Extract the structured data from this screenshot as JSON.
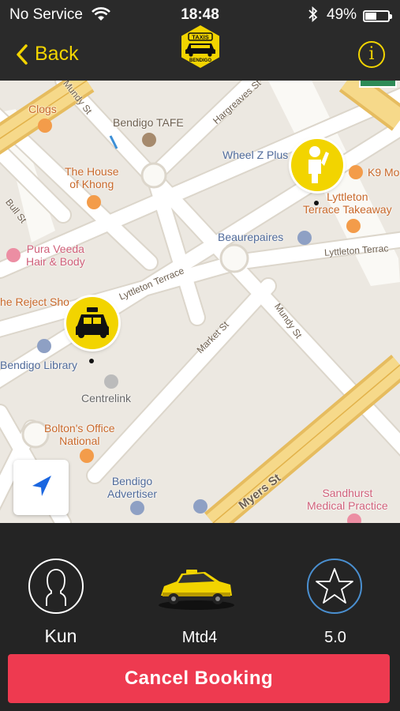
{
  "status_bar": {
    "carrier": "No Service",
    "time": "18:48",
    "battery": "49%",
    "battery_level": 0.49
  },
  "nav": {
    "back_label": "Back",
    "logo_text": "TAXIS",
    "logo_subtext": "BENDIGO",
    "info_label": "i"
  },
  "map": {
    "labels": {
      "clogs": "Clogs",
      "bendigo_tafe": "Bendigo TAFE",
      "the_house_of_khong": "The House\nof Khong",
      "wheel_z_plus": "Wheel Z Plus",
      "k9": "K9 Mo",
      "lyttleton_takeaway": "Lyttleton\nTerrace Takeaway",
      "beaurepaires": "Beaurepaires",
      "pura_veeda": "Pura Veeda\nHair & Body",
      "reject_shop": "he Reject Sho",
      "bendigo_library": "Bendigo Library",
      "centrelink": "Centrelink",
      "boltons": "Bolton's Office\nNational",
      "bendigo_advertiser": "Bendigo\nAdvertiser",
      "sandhurst": "Sandhurst\nMedical Practice",
      "mundy_st_top": "Mundy St",
      "hargreaves": "Hargreaves St",
      "bull_st": "Bull St",
      "lyttleton_terrace": "Lyttleton Terrace",
      "lyttleton_terrace_right": "Lyttleton Terrac",
      "market_st": "Market St",
      "mundy_st": "Mundy St",
      "myers_st": "Myers St"
    }
  },
  "driver": {
    "name": "Kun"
  },
  "vehicle": {
    "id": "Mtd4"
  },
  "rating": {
    "value": "5.0"
  },
  "actions": {
    "cancel_label": "Cancel Booking"
  },
  "colors": {
    "accent": "#f2d400",
    "cancel": "#ee3a50",
    "topbar": "#2a2a2a",
    "bottom": "#242424",
    "map_bg": "#ece8e1",
    "rating_blue": "#4a8fd0"
  }
}
